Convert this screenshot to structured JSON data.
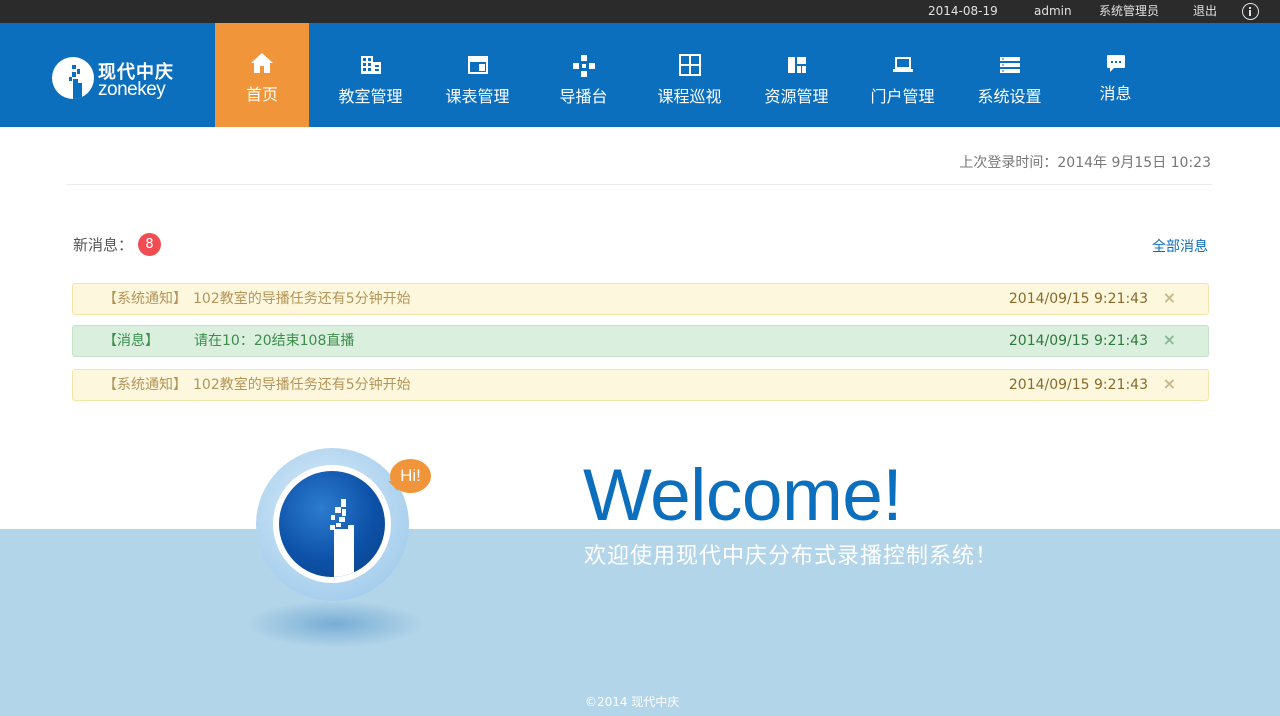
{
  "topbar": {
    "date": "2014-08-19",
    "user": "admin",
    "role": "系统管理员",
    "logout": "退出",
    "info_icon": "info-icon"
  },
  "brand": {
    "name_cn": "现代中庆",
    "name_en": "zonekey",
    "color": "#0c6fbe",
    "accent": "#f0953a"
  },
  "nav": {
    "items": [
      {
        "label": "首页",
        "icon": "home-icon",
        "active": true
      },
      {
        "label": "教室管理",
        "icon": "building-icon",
        "active": false
      },
      {
        "label": "课表管理",
        "icon": "window-icon",
        "active": false
      },
      {
        "label": "导播台",
        "icon": "gamepad-icon",
        "active": false
      },
      {
        "label": "课程巡视",
        "icon": "grid-icon",
        "active": false
      },
      {
        "label": "资源管理",
        "icon": "layout-icon",
        "active": false
      },
      {
        "label": "门户管理",
        "icon": "laptop-icon",
        "active": false
      },
      {
        "label": "系统设置",
        "icon": "server-icon",
        "active": false
      },
      {
        "label": "消息",
        "icon": "chat-icon",
        "active": false
      }
    ]
  },
  "main": {
    "last_login": "上次登录时间：2014年 9月15日  10:23",
    "new_messages_label": "新消息：",
    "new_messages_count": "8",
    "all_messages_link": "全部消息",
    "messages": [
      {
        "type": "warning",
        "tag": "【系统通知】",
        "text": "102教室的导播任务还有5分钟开始",
        "time": "2014/09/15 9:21:43",
        "close": "×"
      },
      {
        "type": "success",
        "tag": "【消息】",
        "text": "请在10：20结束108直播",
        "time": "2014/09/15 9:21:43",
        "close": "×"
      },
      {
        "type": "warning",
        "tag": "【系统通知】",
        "text": "102教室的导播任务还有5分钟开始",
        "time": "2014/09/15 9:21:43",
        "close": "×"
      }
    ]
  },
  "welcome": {
    "hi": "Hi!",
    "title": "Welcome!",
    "subtitle": "欢迎使用现代中庆分布式录播控制系统！"
  },
  "footer": {
    "copyright": "©2014 现代中庆"
  }
}
